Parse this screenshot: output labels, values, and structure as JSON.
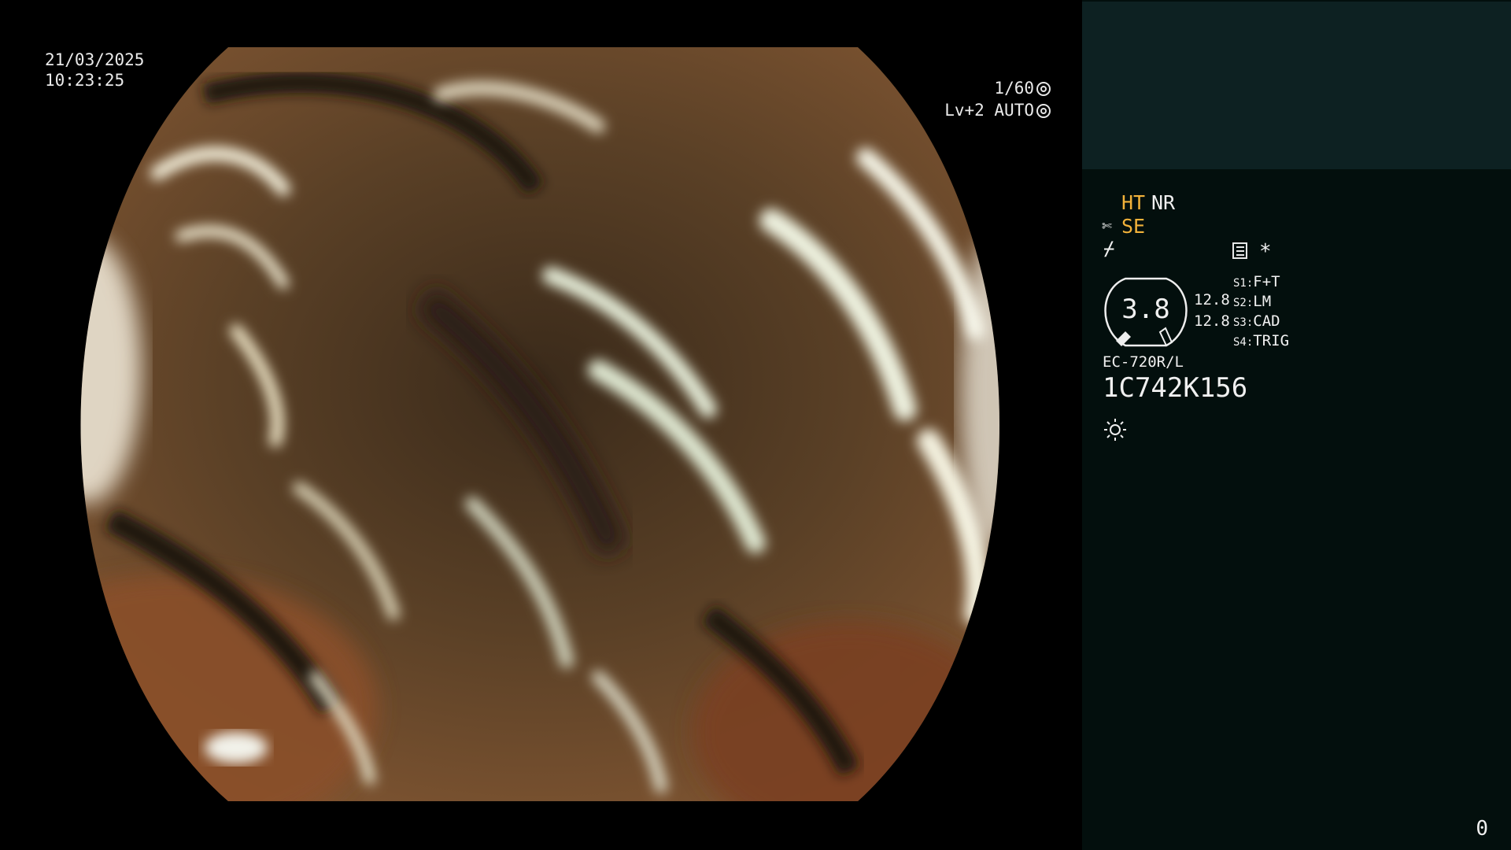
{
  "overlay": {
    "date": "21/03/2025",
    "time": "10:23:25",
    "shutter": "1/60",
    "exposure": "Lv+2 AUTO"
  },
  "panel": {
    "ht": "HT",
    "nr": "NR",
    "se": "SE",
    "star": "*",
    "gauge_value": "3.8",
    "value_1": "12.8",
    "value_2": "12.8",
    "switches": [
      {
        "key": "S1:",
        "label": "F+T"
      },
      {
        "key": "S2:",
        "label": "LM"
      },
      {
        "key": "S3:",
        "label": "CAD"
      },
      {
        "key": "S4:",
        "label": "TRIG"
      }
    ],
    "scope_model": "EC-720R/L",
    "scope_serial": "1C742K156",
    "counter": "0"
  },
  "icons": [
    "shutter-icon",
    "aperture-icon",
    "scissor-icon",
    "zigzag-icon",
    "list-icon",
    "sun-icon"
  ],
  "colors": {
    "accent": "#f2b23a",
    "panel_bg": "#030f0d",
    "panel_top_bg": "#0d2122"
  }
}
